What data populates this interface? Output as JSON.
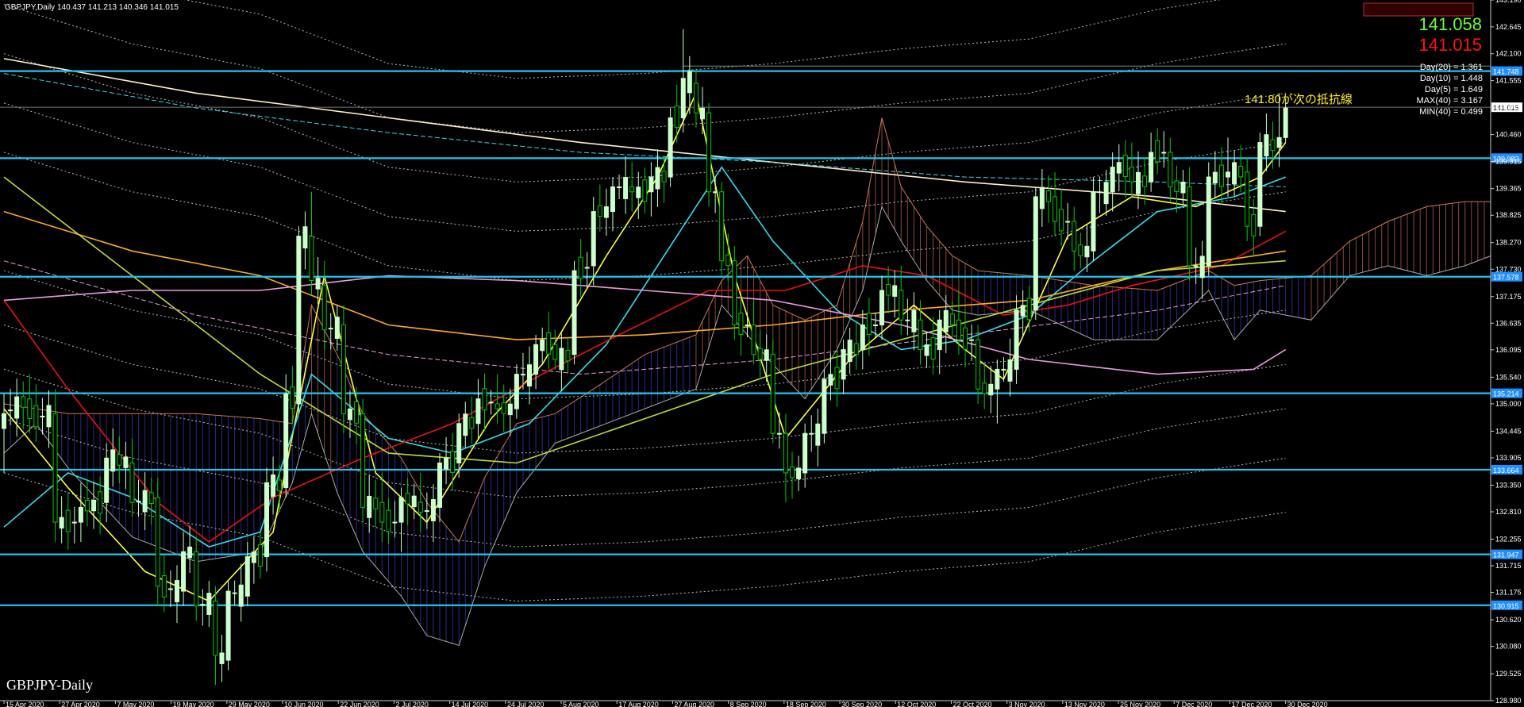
{
  "header": {
    "symbol_line": "GBPJPY,Daily  140.437 141.213 140.346 141.015"
  },
  "watermark": "GBPJPY-Daily",
  "price_box": {
    "bid": "141.058",
    "ask": "141.015"
  },
  "stats": [
    "Day(20) = 1.361",
    "Day(10) = 1.448",
    "Day(5) = 1.649",
    "MAX(40) = 3.167",
    "MIN(40) = 0.499"
  ],
  "annotation": "141.80が次の抵抗線",
  "colors": {
    "background": "#000000",
    "bull": "#ccffcc",
    "bear": "#00cc00",
    "hline": "#22c4ee",
    "ma_yellow": "#ffff33",
    "ma_cyan": "#33ddee",
    "ma_red": "#ee1111",
    "ma_orange": "#ffaa22",
    "ma_green": "#bbdd33",
    "ma_pink": "#ee99dd",
    "ma_white": "#ffeecc",
    "bid": "#66ff33",
    "ask": "#ff1111",
    "annotation": "#ffee22"
  },
  "chart_data": {
    "type": "candlestick",
    "symbol": "GBPJPY",
    "timeframe": "Daily",
    "y_ticks": [
      "143.190",
      "142.645",
      "142.100",
      "141.555",
      "141.015",
      "140.460",
      "139.915",
      "139.365",
      "138.825",
      "138.270",
      "137.730",
      "137.175",
      "136.635",
      "136.095",
      "135.540",
      "135.000",
      "134.445",
      "133.905",
      "133.350",
      "132.810",
      "132.255",
      "131.715",
      "131.175",
      "130.620",
      "130.080",
      "129.525",
      "128.980"
    ],
    "ylim": [
      128.98,
      143.19
    ],
    "x_ticks": [
      "15 Apr 2020",
      "27 Apr 2020",
      "7 May 2020",
      "19 May 2020",
      "29 May 2020",
      "10 Jun 2020",
      "22 Jun 2020",
      "2 Jul 2020",
      "14 Jul 2020",
      "24 Jul 2020",
      "5 Aug 2020",
      "17 Aug 2020",
      "27 Aug 2020",
      "8 Sep 2020",
      "18 Sep 2020",
      "30 Sep 2020",
      "12 Oct 2020",
      "22 Oct 2020",
      "3 Nov 2020",
      "13 Nov 2020",
      "25 Nov 2020",
      "7 Dec 2020",
      "17 Dec 2020",
      "30 Dec 2020"
    ],
    "horizontal_lines": [
      {
        "price": 141.748,
        "label": "141.748"
      },
      {
        "price": 139.982,
        "label": "139.982"
      },
      {
        "price": 137.578,
        "label": "137.578"
      },
      {
        "price": 135.214,
        "label": "135.214"
      },
      {
        "price": 133.664,
        "label": "133.664"
      },
      {
        "price": 131.947,
        "label": "131.947"
      },
      {
        "price": 130.915,
        "label": "130.915"
      }
    ],
    "last_price": 141.015,
    "candle_anchors": [
      [
        0,
        134.5,
        135.2,
        133.6,
        134.8
      ],
      [
        4,
        135.1,
        135.6,
        134.4,
        134.7
      ],
      [
        8,
        134.8,
        135.3,
        132.2,
        132.6
      ],
      [
        12,
        132.6,
        133.4,
        132.2,
        132.9
      ],
      [
        16,
        133.0,
        134.2,
        132.6,
        133.9
      ],
      [
        20,
        133.8,
        134.3,
        132.7,
        133.0
      ],
      [
        24,
        133.1,
        133.5,
        130.9,
        131.3
      ],
      [
        28,
        131.2,
        132.4,
        130.9,
        132.0
      ],
      [
        30,
        132.0,
        132.3,
        130.6,
        130.9
      ],
      [
        33,
        131.0,
        131.3,
        129.3,
        129.9
      ],
      [
        35,
        129.8,
        131.4,
        129.6,
        131.2
      ],
      [
        38,
        131.1,
        132.2,
        130.9,
        131.9
      ],
      [
        41,
        131.9,
        133.7,
        131.6,
        133.4
      ],
      [
        44,
        133.3,
        135.6,
        133.1,
        135.2
      ],
      [
        46,
        135.0,
        138.6,
        134.8,
        138.4
      ],
      [
        48,
        138.4,
        139.3,
        137.2,
        137.5
      ],
      [
        50,
        137.4,
        137.9,
        136.1,
        136.5
      ],
      [
        53,
        136.6,
        137.0,
        134.4,
        134.8
      ],
      [
        56,
        134.8,
        135.1,
        132.6,
        132.9
      ],
      [
        59,
        133.0,
        133.6,
        132.2,
        132.6
      ],
      [
        62,
        132.6,
        133.3,
        132.0,
        133.1
      ],
      [
        65,
        133.0,
        133.6,
        132.4,
        132.8
      ],
      [
        68,
        132.9,
        134.0,
        132.6,
        133.8
      ],
      [
        71,
        133.8,
        134.8,
        133.5,
        134.6
      ],
      [
        74,
        134.6,
        135.5,
        134.3,
        135.1
      ],
      [
        77,
        135.0,
        135.6,
        134.6,
        134.9
      ],
      [
        80,
        134.9,
        135.8,
        134.7,
        135.6
      ],
      [
        83,
        135.6,
        136.4,
        135.3,
        136.2
      ],
      [
        86,
        136.2,
        136.5,
        135.7,
        135.9
      ],
      [
        89,
        136.0,
        137.9,
        135.8,
        137.7
      ],
      [
        92,
        137.8,
        139.2,
        137.4,
        138.9
      ],
      [
        95,
        138.9,
        139.6,
        138.5,
        139.4
      ],
      [
        98,
        139.4,
        139.9,
        138.9,
        139.3
      ],
      [
        101,
        139.3,
        139.9,
        138.8,
        139.6
      ],
      [
        104,
        139.6,
        141.0,
        139.4,
        140.8
      ],
      [
        106,
        140.8,
        142.6,
        140.5,
        141.6
      ],
      [
        108,
        141.5,
        141.8,
        140.6,
        140.9
      ],
      [
        110,
        140.9,
        141.1,
        139.0,
        139.3
      ],
      [
        112,
        139.3,
        139.5,
        137.6,
        137.9
      ],
      [
        114,
        137.9,
        138.2,
        136.3,
        136.6
      ],
      [
        117,
        136.6,
        137.1,
        135.8,
        136.0
      ],
      [
        120,
        136.0,
        136.3,
        134.2,
        134.4
      ],
      [
        122,
        134.4,
        134.8,
        133.0,
        133.6
      ],
      [
        125,
        133.6,
        134.6,
        133.3,
        134.4
      ],
      [
        128,
        134.4,
        135.7,
        134.2,
        135.5
      ],
      [
        131,
        135.5,
        136.3,
        135.2,
        136.1
      ],
      [
        134,
        136.1,
        136.9,
        135.7,
        136.6
      ],
      [
        137,
        136.6,
        137.6,
        136.3,
        137.3
      ],
      [
        140,
        137.3,
        137.8,
        136.4,
        136.7
      ],
      [
        143,
        136.7,
        137.1,
        135.8,
        136.1
      ],
      [
        146,
        136.1,
        136.9,
        135.6,
        136.7
      ],
      [
        149,
        136.7,
        137.3,
        136.0,
        136.3
      ],
      [
        152,
        136.3,
        136.6,
        135.0,
        135.3
      ],
      [
        155,
        135.3,
        135.9,
        134.6,
        135.7
      ],
      [
        158,
        135.7,
        137.2,
        135.4,
        136.9
      ],
      [
        161,
        136.9,
        139.4,
        136.7,
        139.2
      ],
      [
        164,
        139.2,
        139.7,
        138.4,
        138.7
      ],
      [
        167,
        138.7,
        139.0,
        137.7,
        138.1
      ],
      [
        170,
        138.1,
        139.6,
        137.9,
        139.3
      ],
      [
        173,
        139.3,
        140.1,
        138.9,
        139.8
      ],
      [
        176,
        139.8,
        140.3,
        139.2,
        139.5
      ],
      [
        179,
        139.5,
        140.5,
        139.3,
        140.1
      ],
      [
        182,
        140.1,
        140.4,
        139.1,
        139.4
      ],
      [
        185,
        139.4,
        139.8,
        137.5,
        137.8
      ],
      [
        188,
        137.8,
        139.9,
        137.6,
        139.6
      ],
      [
        191,
        139.6,
        140.4,
        139.2,
        139.7
      ],
      [
        194,
        139.7,
        140.0,
        138.3,
        138.6
      ],
      [
        196,
        138.6,
        140.5,
        138.4,
        140.3
      ],
      [
        199,
        140.2,
        141.3,
        139.8,
        140.4
      ],
      [
        200,
        140.4,
        141.2,
        140.3,
        141.0
      ]
    ],
    "moving_averages": [
      {
        "color": "yellow",
        "style": "solid",
        "points": [
          [
            0,
            134.9
          ],
          [
            10,
            133.3
          ],
          [
            22,
            131.6
          ],
          [
            32,
            131.0
          ],
          [
            42,
            132.4
          ],
          [
            50,
            137.6
          ],
          [
            58,
            133.6
          ],
          [
            66,
            132.6
          ],
          [
            76,
            134.7
          ],
          [
            84,
            135.8
          ],
          [
            94,
            138.0
          ],
          [
            102,
            139.6
          ],
          [
            108,
            141.3
          ],
          [
            114,
            137.6
          ],
          [
            122,
            134.3
          ],
          [
            132,
            135.9
          ],
          [
            142,
            137.0
          ],
          [
            150,
            136.1
          ],
          [
            156,
            135.5
          ],
          [
            166,
            138.4
          ],
          [
            176,
            139.2
          ],
          [
            186,
            139.0
          ],
          [
            196,
            139.6
          ],
          [
            200,
            140.3
          ]
        ]
      },
      {
        "color": "cyan",
        "style": "solid",
        "points": [
          [
            0,
            132.5
          ],
          [
            10,
            133.6
          ],
          [
            20,
            133.1
          ],
          [
            32,
            132.1
          ],
          [
            40,
            132.4
          ],
          [
            48,
            135.6
          ],
          [
            60,
            134.3
          ],
          [
            70,
            134.0
          ],
          [
            82,
            134.6
          ],
          [
            94,
            136.2
          ],
          [
            104,
            138.2
          ],
          [
            112,
            139.8
          ],
          [
            120,
            138.3
          ],
          [
            130,
            136.9
          ],
          [
            140,
            136.1
          ],
          [
            150,
            136.3
          ],
          [
            160,
            136.8
          ],
          [
            170,
            137.9
          ],
          [
            180,
            138.9
          ],
          [
            192,
            139.2
          ],
          [
            200,
            139.6
          ]
        ]
      },
      {
        "color": "red",
        "style": "solid",
        "points": [
          [
            0,
            137.1
          ],
          [
            10,
            135.3
          ],
          [
            24,
            133.0
          ],
          [
            32,
            132.2
          ],
          [
            42,
            133.1
          ],
          [
            56,
            133.9
          ],
          [
            70,
            134.6
          ],
          [
            84,
            135.6
          ],
          [
            96,
            136.4
          ],
          [
            110,
            137.3
          ],
          [
            122,
            137.3
          ],
          [
            134,
            137.8
          ],
          [
            144,
            137.6
          ],
          [
            156,
            136.8
          ],
          [
            166,
            137.0
          ],
          [
            176,
            137.4
          ],
          [
            190,
            137.8
          ],
          [
            200,
            138.5
          ]
        ]
      },
      {
        "color": "orange",
        "style": "solid",
        "points": [
          [
            0,
            138.9
          ],
          [
            20,
            138.1
          ],
          [
            40,
            137.6
          ],
          [
            60,
            136.6
          ],
          [
            80,
            136.3
          ],
          [
            100,
            136.4
          ],
          [
            120,
            136.6
          ],
          [
            140,
            136.9
          ],
          [
            160,
            137.1
          ],
          [
            180,
            137.7
          ],
          [
            200,
            138.1
          ]
        ]
      },
      {
        "color": "green",
        "style": "solid",
        "points": [
          [
            0,
            139.6
          ],
          [
            20,
            137.6
          ],
          [
            40,
            135.6
          ],
          [
            60,
            134.0
          ],
          [
            80,
            133.8
          ],
          [
            100,
            134.7
          ],
          [
            120,
            135.6
          ],
          [
            140,
            136.3
          ],
          [
            160,
            137.0
          ],
          [
            180,
            137.7
          ],
          [
            200,
            137.9
          ]
        ]
      },
      {
        "color": "pink",
        "style": "solid",
        "points": [
          [
            0,
            137.1
          ],
          [
            20,
            137.3
          ],
          [
            40,
            137.3
          ],
          [
            60,
            137.6
          ],
          [
            80,
            137.5
          ],
          [
            100,
            137.3
          ],
          [
            120,
            137.1
          ],
          [
            140,
            136.6
          ],
          [
            160,
            135.9
          ],
          [
            180,
            135.6
          ],
          [
            195,
            135.7
          ],
          [
            200,
            136.1
          ]
        ]
      },
      {
        "color": "white",
        "style": "solid",
        "points": [
          [
            0,
            142.0
          ],
          [
            30,
            141.3
          ],
          [
            60,
            140.8
          ],
          [
            90,
            140.3
          ],
          [
            120,
            139.9
          ],
          [
            150,
            139.5
          ],
          [
            180,
            139.2
          ],
          [
            200,
            138.9
          ]
        ]
      },
      {
        "color": "cyan",
        "style": "dashed",
        "points": [
          [
            0,
            141.7
          ],
          [
            30,
            141.0
          ],
          [
            60,
            140.5
          ],
          [
            90,
            140.1
          ],
          [
            120,
            139.9
          ],
          [
            150,
            139.6
          ],
          [
            180,
            139.5
          ],
          [
            200,
            139.4
          ]
        ]
      },
      {
        "color": "pink",
        "style": "dashed",
        "points": [
          [
            0,
            137.9
          ],
          [
            30,
            136.8
          ],
          [
            60,
            136.0
          ],
          [
            90,
            135.6
          ],
          [
            120,
            135.9
          ],
          [
            150,
            136.4
          ],
          [
            180,
            136.9
          ],
          [
            200,
            137.4
          ]
        ]
      }
    ],
    "band_offsets": [
      -5.3,
      -4.2,
      -3.2,
      -2.3,
      -1.2,
      1.2,
      2.2,
      3.2,
      4.2,
      5.3
    ],
    "ichimoku_cloud": [
      [
        0,
        135.0,
        134.0
      ],
      [
        5,
        134.9,
        134.6
      ],
      [
        10,
        134.8,
        133.7
      ],
      [
        20,
        134.8,
        132.3
      ],
      [
        30,
        134.8,
        131.8
      ],
      [
        40,
        134.7,
        132.0
      ],
      [
        45,
        134.6,
        133.4
      ],
      [
        48,
        137.0,
        134.8
      ],
      [
        52,
        136.0,
        133.2
      ],
      [
        56,
        134.8,
        132.0
      ],
      [
        62,
        133.9,
        131.1
      ],
      [
        66,
        133.0,
        130.3
      ],
      [
        71,
        132.2,
        130.1
      ],
      [
        75,
        133.5,
        131.7
      ],
      [
        80,
        134.6,
        133.2
      ],
      [
        86,
        134.8,
        134.2
      ],
      [
        92,
        135.3,
        134.5
      ],
      [
        100,
        136.0,
        134.9
      ],
      [
        108,
        136.4,
        135.3
      ],
      [
        112,
        137.5,
        137.0
      ],
      [
        116,
        138.0,
        136.4
      ],
      [
        120,
        137.0,
        135.8
      ],
      [
        125,
        136.7,
        135.1
      ],
      [
        130,
        137.0,
        136.1
      ],
      [
        134,
        138.7,
        137.3
      ],
      [
        137,
        140.8,
        139.0
      ],
      [
        140,
        139.4,
        138.3
      ],
      [
        144,
        138.6,
        137.5
      ],
      [
        148,
        138.0,
        136.9
      ],
      [
        152,
        137.7,
        136.8
      ],
      [
        160,
        137.6,
        136.9
      ],
      [
        170,
        137.4,
        136.3
      ],
      [
        180,
        137.3,
        136.3
      ],
      [
        188,
        137.7,
        137.3
      ],
      [
        192,
        137.4,
        136.3
      ],
      [
        196,
        137.5,
        136.9
      ],
      [
        204,
        137.6,
        136.7
      ],
      [
        210,
        138.3,
        137.6
      ],
      [
        216,
        138.7,
        137.8
      ],
      [
        222,
        139.0,
        137.6
      ],
      [
        228,
        139.1,
        137.8
      ],
      [
        232,
        139.1,
        138.0
      ]
    ]
  }
}
